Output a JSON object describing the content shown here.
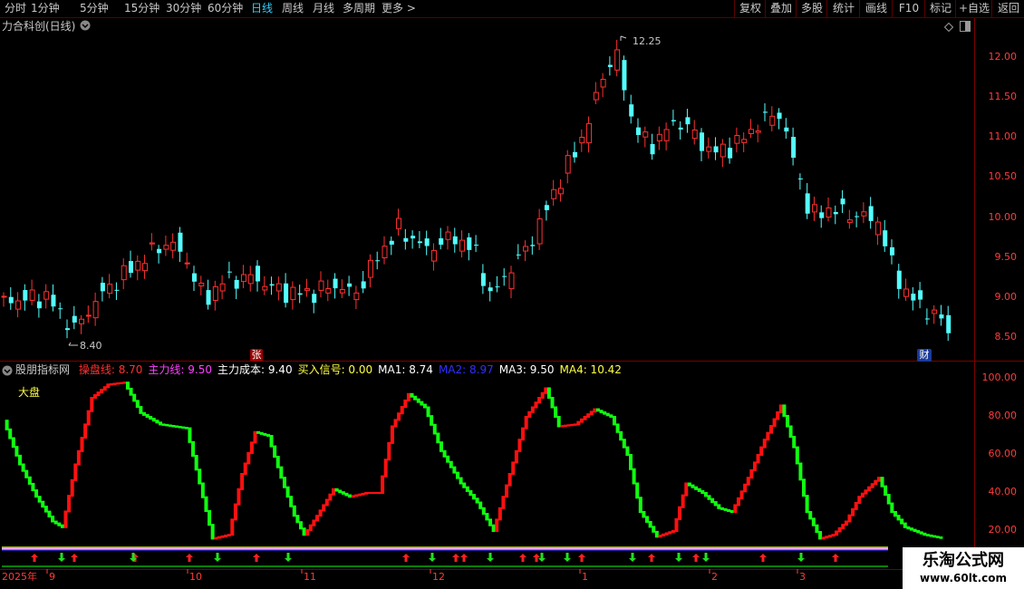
{
  "toolbar": {
    "timeframes": [
      "分时",
      "1分钟",
      "5分钟",
      "15分钟",
      "30分钟",
      "60分钟",
      "日线",
      "周线",
      "月线",
      "多周期",
      "更多 >"
    ],
    "active": "日线",
    "right_buttons": [
      "复权",
      "叠加",
      "多股",
      "统计",
      "画线",
      "F10",
      "标记",
      "+自选",
      "返回"
    ]
  },
  "main_chart": {
    "title": "力合科创(日线)",
    "high_label": "12.25",
    "low_label": "8.40",
    "y_ticks": [
      "12.00",
      "11.50",
      "11.00",
      "10.50",
      "10.00",
      "9.50",
      "9.00",
      "8.50"
    ],
    "markers": {
      "zhang": "张",
      "cai": "财"
    }
  },
  "indicator": {
    "name": "股朋指标网",
    "items": [
      {
        "label": "操盘线:",
        "value": "8.70",
        "color": "#ff3030"
      },
      {
        "label": "主力线:",
        "value": "9.50",
        "color": "#ff40ff"
      },
      {
        "label": "主力成本:",
        "value": "9.40",
        "color": "#ffffff"
      },
      {
        "label": "买入信号:",
        "value": "0.00",
        "color": "#ffff40"
      },
      {
        "label": "MA1:",
        "value": "8.74",
        "color": "#ffffff"
      },
      {
        "label": "MA2:",
        "value": "8.97",
        "color": "#3030ff"
      },
      {
        "label": "MA3:",
        "value": "9.50",
        "color": "#ffffff"
      },
      {
        "label": "MA4:",
        "value": "10.42",
        "color": "#ffff40"
      }
    ],
    "sub_label": "大盘",
    "y_ticks": [
      "100.00",
      "80.00",
      "60.00",
      "40.00",
      "20.00"
    ]
  },
  "x_axis": {
    "labels": [
      "2025年",
      "9",
      "10",
      "11",
      "12",
      "1",
      "2",
      "3"
    ]
  },
  "watermark": {
    "title": "乐淘公式网",
    "url": "www.60lt.com"
  },
  "colors": {
    "up": "#ff3030",
    "down": "#54ffff",
    "grid": "#7a0000",
    "ind_up": "#ff1010",
    "ind_down": "#10ff10"
  }
}
